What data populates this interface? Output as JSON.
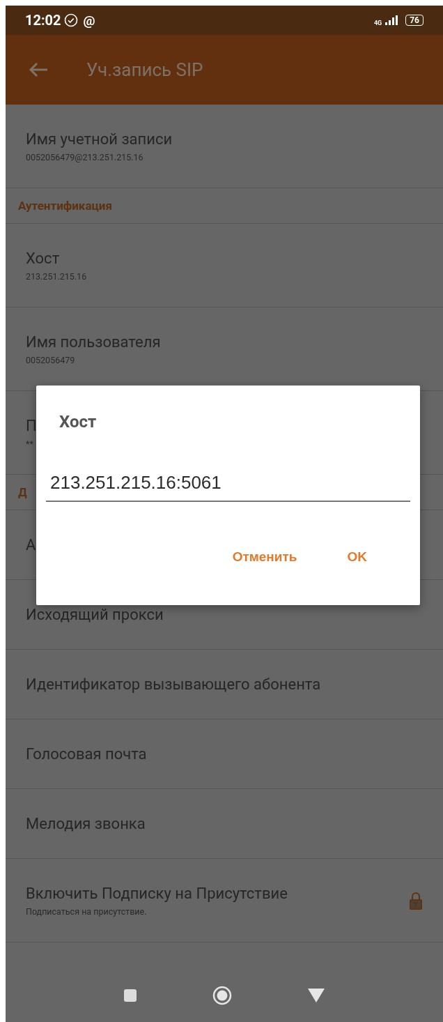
{
  "status_bar": {
    "time": "12:02",
    "notification": "@",
    "network": "4G",
    "battery": "76"
  },
  "app_bar": {
    "title": "Уч.запись SIP"
  },
  "preferences": [
    {
      "kind": "item",
      "title": "Имя учетной записи",
      "summary": "0052056479@213.251.215.16"
    },
    {
      "kind": "category",
      "title": "Аутентификация"
    },
    {
      "kind": "item",
      "title": "Хост",
      "summary": "213.251.215.16"
    },
    {
      "kind": "item",
      "title": "Имя пользователя",
      "summary": "0052056479"
    },
    {
      "kind": "item",
      "title": "П",
      "summary": "**"
    },
    {
      "kind": "category",
      "title": "Д"
    },
    {
      "kind": "item",
      "title": "А"
    },
    {
      "kind": "item",
      "title": "Исходящий прокси"
    },
    {
      "kind": "item",
      "title": "Идентификатор вызывающего абонента"
    },
    {
      "kind": "item",
      "title": "Голосовая почта"
    },
    {
      "kind": "item",
      "title": "Мелодия звонка"
    },
    {
      "kind": "item",
      "title": "Включить Подписку на Присутствие",
      "summary": "Подписаться на присутствие.",
      "locked": true
    }
  ],
  "dialog": {
    "title": "Хост",
    "value": "213.251.215.16:5061",
    "buttons": [
      "Отменить",
      "OK"
    ]
  }
}
